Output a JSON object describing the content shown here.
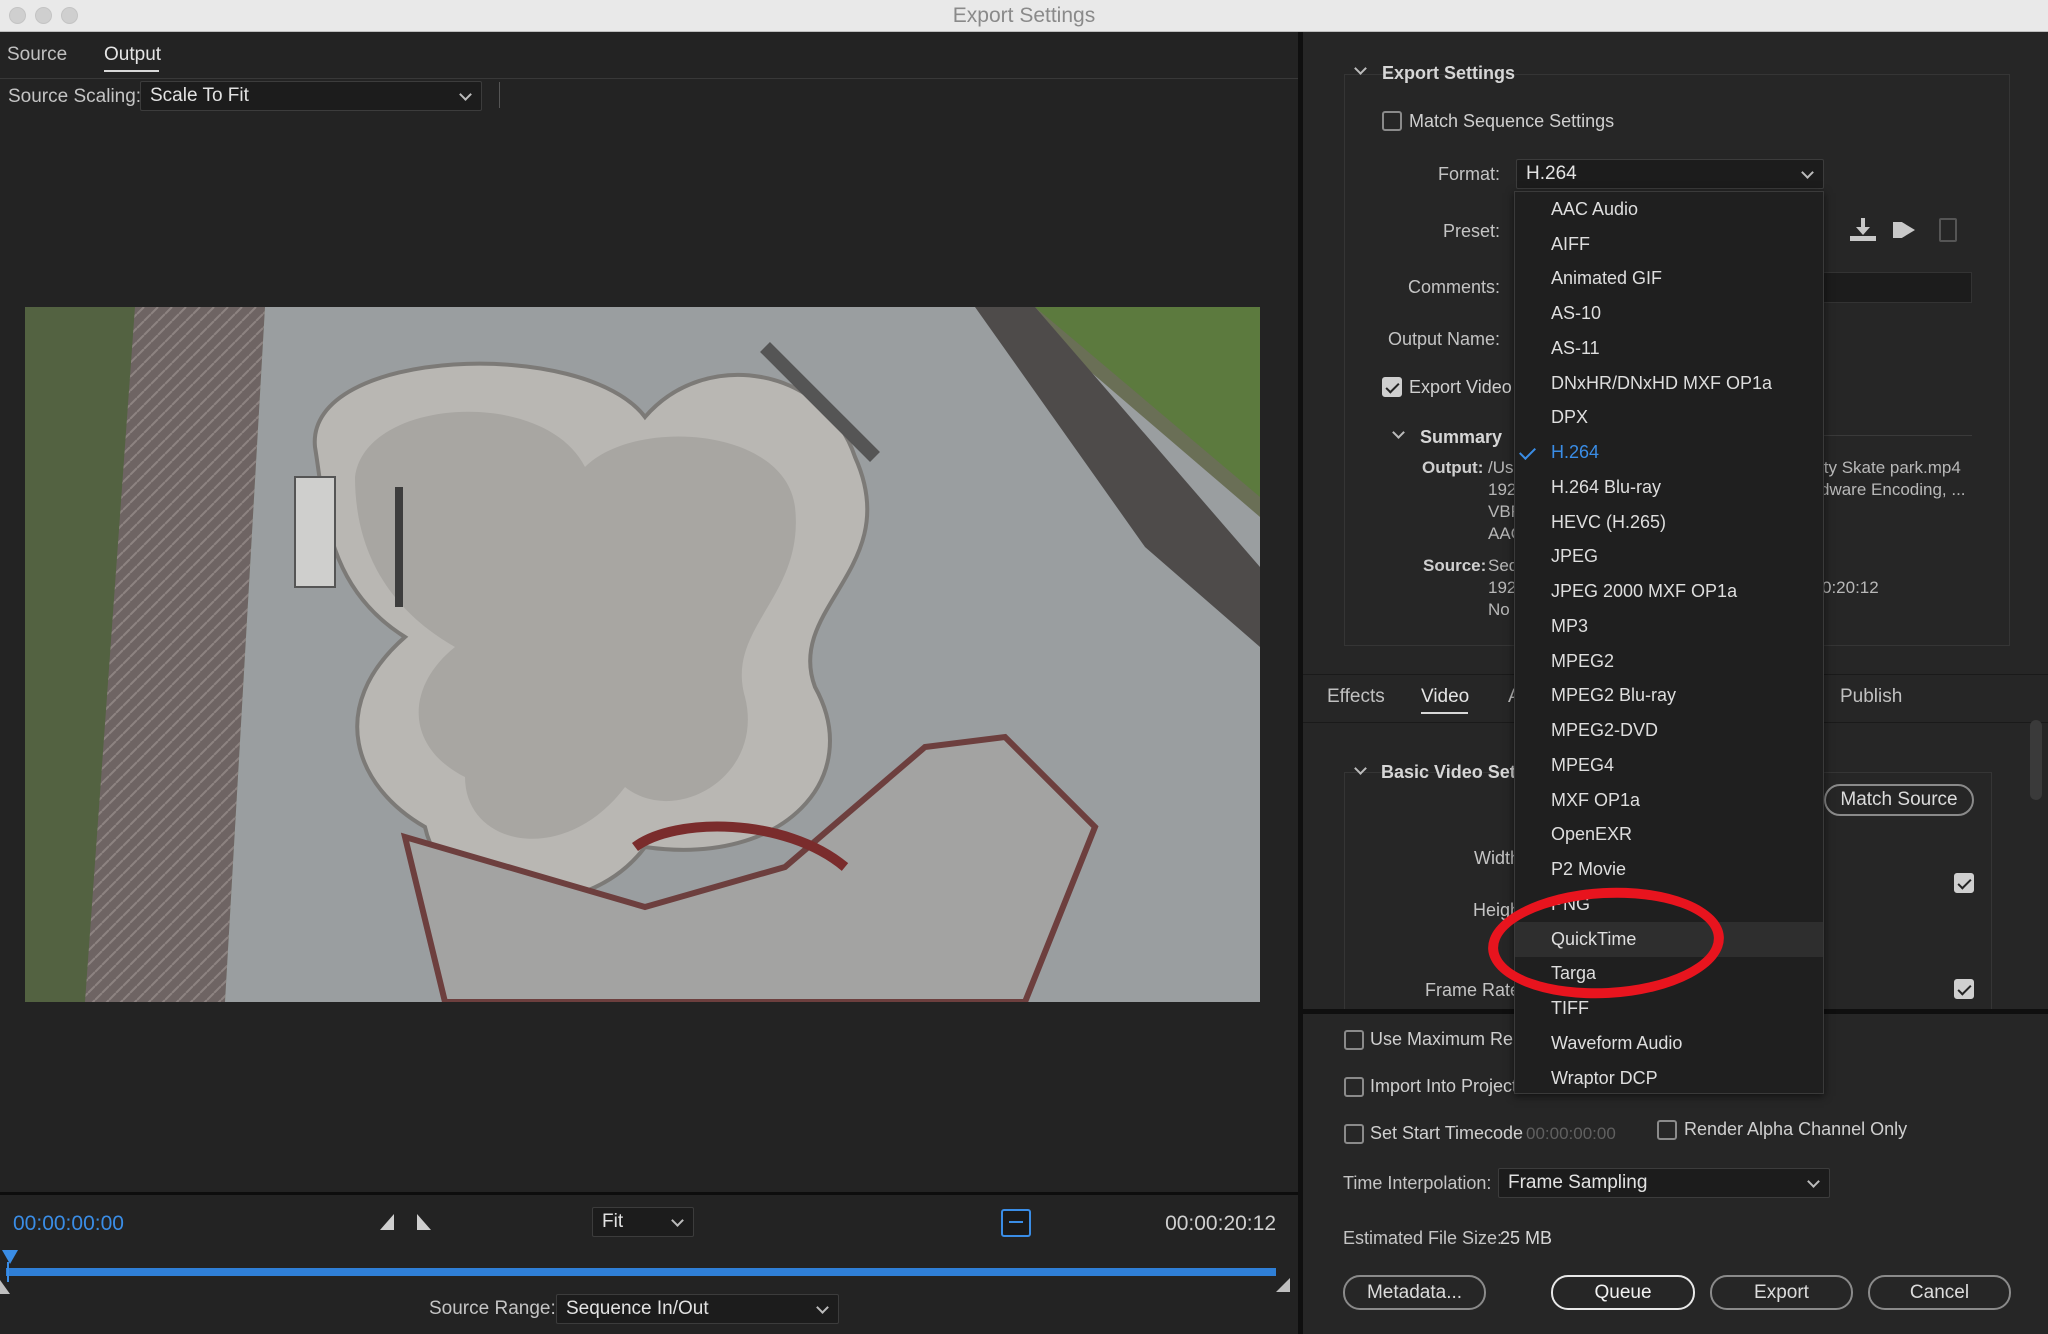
{
  "window": {
    "title": "Export Settings"
  },
  "left": {
    "tabs": [
      {
        "label": "Source"
      },
      {
        "label": "Output"
      }
    ],
    "source_scaling": {
      "label": "Source Scaling:",
      "value": "Scale To Fit"
    },
    "timeline": {
      "current_time": "00:00:00:00",
      "duration": "00:00:20:12",
      "zoom": "Fit",
      "source_range_label": "Source Range:",
      "source_range_value": "Sequence In/Out",
      "playhead_position": 0
    }
  },
  "right": {
    "export_settings": {
      "header": "Export Settings",
      "match_sequence": {
        "label": "Match Sequence Settings",
        "checked": false
      },
      "format": {
        "label": "Format:",
        "value": "H.264"
      },
      "preset_label": "Preset:",
      "comments_label": "Comments:",
      "output_name_label": "Output Name:",
      "export_video": {
        "label": "Export Video",
        "checked": true
      },
      "summary": {
        "header": "Summary",
        "output_label": "Output:",
        "output_lines": [
          "/Us",
          "192",
          "VBF",
          "AAC"
        ],
        "output_right_1": "ity Skate park.mp4",
        "output_right_2": "dware Encoding, ...",
        "source_label": "Source:",
        "source_lines": [
          "Seq",
          "192",
          "No"
        ],
        "source_right": "0:20:12"
      }
    },
    "tabs": [
      {
        "label": "Effects"
      },
      {
        "label": "Video"
      },
      {
        "label": "A"
      },
      {
        "label": "Publish"
      }
    ],
    "basic_video": {
      "header": "Basic Video Setti",
      "match_source": "Match Source",
      "width_label": "Width",
      "height_label": "Heigh",
      "frame_rate_label": "Frame Rate"
    },
    "options": {
      "use_max_render": "Use Maximum Ren",
      "import_into_project": "Import Into Project",
      "set_start_timecode": "Set Start Timecode",
      "start_timecode_value": "00:00:00:00",
      "render_alpha": "Render Alpha Channel Only",
      "time_interpolation_label": "Time Interpolation:",
      "time_interpolation_value": "Frame Sampling",
      "file_size_label": "Estimated File Size:",
      "file_size_value": "25 MB"
    },
    "buttons": {
      "metadata": "Metadata...",
      "queue": "Queue",
      "export": "Export",
      "cancel": "Cancel"
    }
  },
  "format_menu": {
    "items": [
      "AAC Audio",
      "AIFF",
      "Animated GIF",
      "AS-10",
      "AS-11",
      "DNxHR/DNxHD MXF OP1a",
      "DPX",
      "H.264",
      "H.264 Blu-ray",
      "HEVC (H.265)",
      "JPEG",
      "JPEG 2000 MXF OP1a",
      "MP3",
      "MPEG2",
      "MPEG2 Blu-ray",
      "MPEG2-DVD",
      "MPEG4",
      "MXF OP1a",
      "OpenEXR",
      "P2 Movie",
      "PNG",
      "QuickTime",
      "Targa",
      "TIFF",
      "Waveform Audio",
      "Wraptor DCP"
    ],
    "selected": "H.264",
    "highlighted": "QuickTime"
  },
  "colors": {
    "accent": "#3a8de6",
    "annotation": "#e8141e",
    "background": "#232323"
  }
}
